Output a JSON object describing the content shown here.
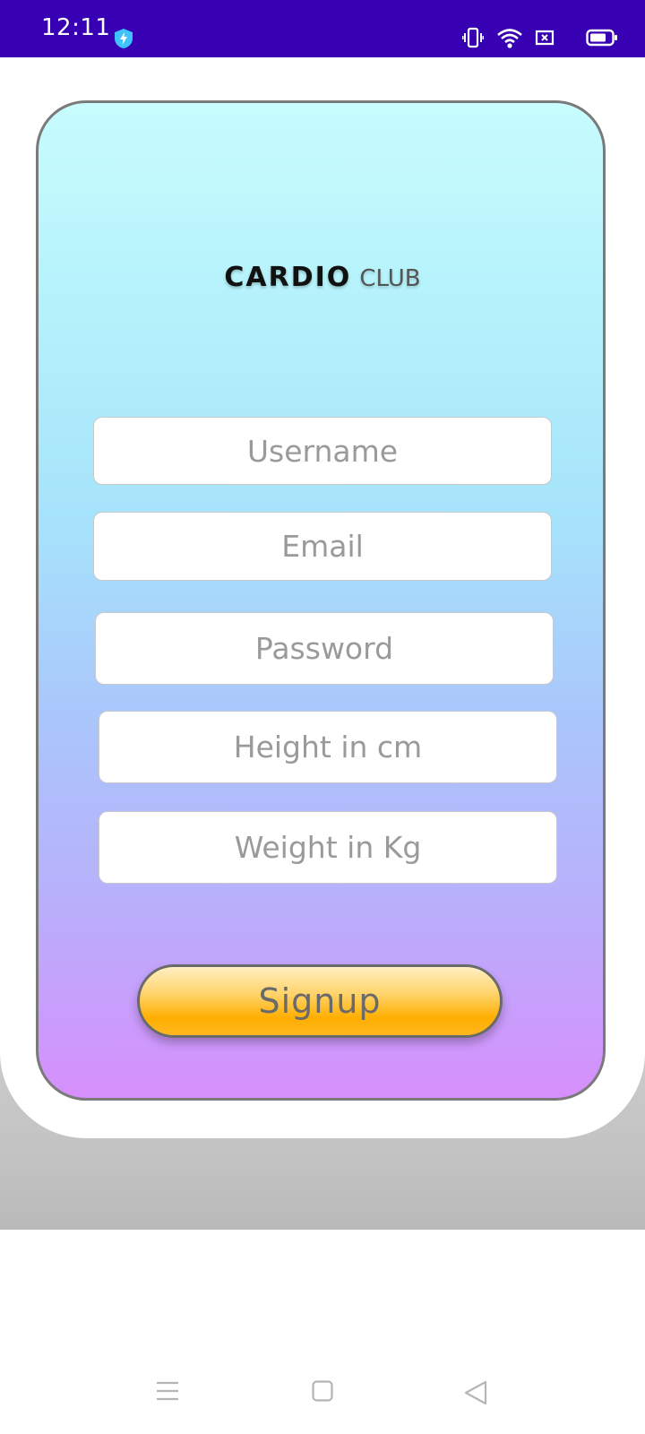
{
  "status_bar": {
    "time": "12:11",
    "background": "#3700b3",
    "icons": [
      "shield-bolt-icon",
      "vibrate-icon",
      "wifi-icon",
      "sim-icon",
      "battery-icon"
    ]
  },
  "app": {
    "brand_main": "CARDIO",
    "brand_sub": "CLUB",
    "gradient_colors": [
      "#c8fcfd",
      "#a6e3fb",
      "#aac6fb",
      "#d68ffc"
    ]
  },
  "form": {
    "username_placeholder": "Username",
    "email_placeholder": "Email",
    "password_placeholder": "Password",
    "height_placeholder": "Height in cm",
    "weight_placeholder": "Weight in Kg",
    "signup_label": "Signup",
    "signup_color": "#ffae00"
  },
  "nav_bar": {
    "icons": [
      "menu-icon",
      "home-square-icon",
      "back-triangle-icon"
    ]
  }
}
